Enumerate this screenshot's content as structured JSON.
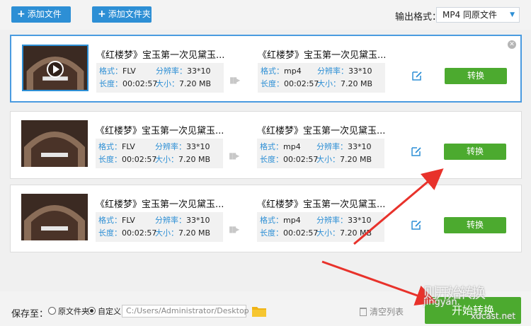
{
  "toolbar": {
    "add_file": "添加文件",
    "add_folder": "添加文件夹",
    "output_format_label": "输出格式：",
    "output_format_value": "MP4  同原文件"
  },
  "items": [
    {
      "selected": true,
      "src_title": "《红楼梦》宝玉第一次见黛玉...",
      "dst_title": "《红楼梦》宝玉第一次见黛玉...",
      "src": {
        "format_k": "格式：",
        "format": "FLV",
        "res_k": "分辨率：",
        "res": "33*10",
        "len_k": "长度：",
        "len": "00:02:57",
        "size_k": "大小：",
        "size": "7.20 MB"
      },
      "dst": {
        "format_k": "格式：",
        "format": "mp4",
        "res_k": "分辨率：",
        "res": "33*10",
        "len_k": "长度：",
        "len": "00:02:57",
        "size_k": "大小：",
        "size": "7.20 MB"
      },
      "convert": "转换"
    },
    {
      "selected": false,
      "src_title": "《红楼梦》宝玉第一次见黛玉...",
      "dst_title": "《红楼梦》宝玉第一次见黛玉...",
      "src": {
        "format_k": "格式：",
        "format": "FLV",
        "res_k": "分辨率：",
        "res": "33*10",
        "len_k": "长度：",
        "len": "00:02:57",
        "size_k": "大小：",
        "size": "7.20 MB"
      },
      "dst": {
        "format_k": "格式：",
        "format": "mp4",
        "res_k": "分辨率：",
        "res": "33*10",
        "len_k": "长度：",
        "len": "00:02:57",
        "size_k": "大小：",
        "size": "7.20 MB"
      },
      "convert": "转换"
    },
    {
      "selected": false,
      "src_title": "《红楼梦》宝玉第一次见黛玉...",
      "dst_title": "《红楼梦》宝玉第一次见黛玉...",
      "src": {
        "format_k": "格式：",
        "format": "FLV",
        "res_k": "分辨率：",
        "res": "33*10",
        "len_k": "长度：",
        "len": "00:02:57",
        "size_k": "大小：",
        "size": "7.20 MB"
      },
      "dst": {
        "format_k": "格式：",
        "format": "mp4",
        "res_k": "分辨率：",
        "res": "33*10",
        "len_k": "长度：",
        "len": "00:02:57",
        "size_k": "大小：",
        "size": "7.20 MB"
      },
      "convert": "转换"
    }
  ],
  "footer": {
    "save_to": "保存至：",
    "opt_original": "原文件夹",
    "opt_custom": "自定义",
    "path": "C:/Users/Administrator/Desktop",
    "clear_list": "清空列表",
    "start": "开始转换"
  },
  "watermark": {
    "line1": "则开始转换",
    "line2": "jingyan.",
    "line3": "xdcast.net"
  },
  "colors": {
    "accent": "#2d8fd5",
    "convert_green": "#4caa2f",
    "annotation_red": "#e8322b"
  }
}
